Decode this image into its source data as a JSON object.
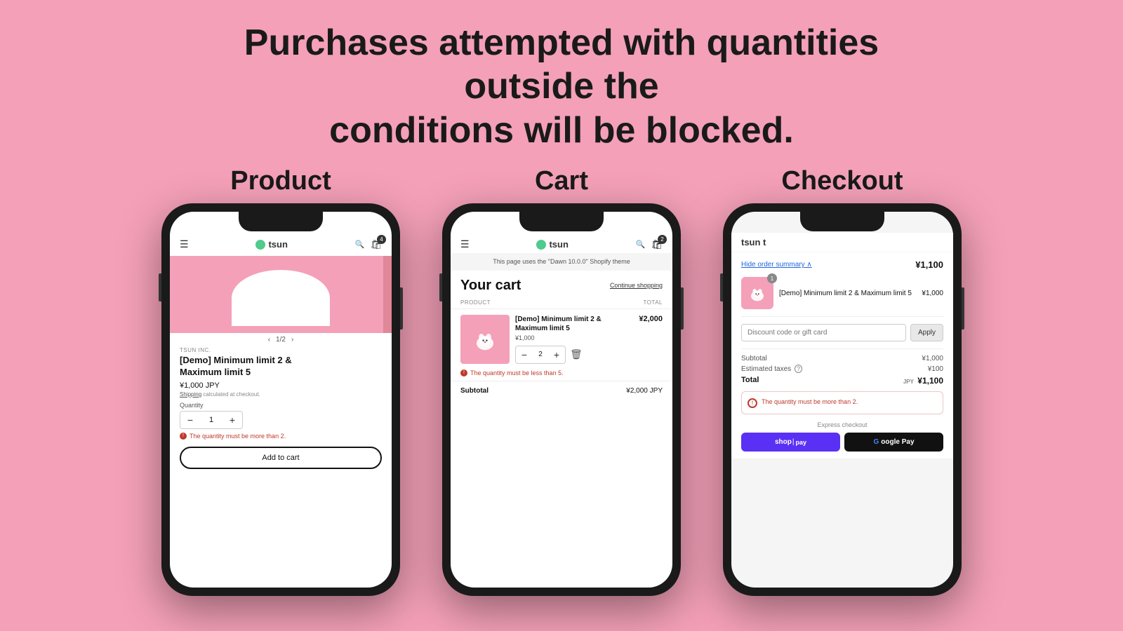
{
  "headline": {
    "line1": "Purchases attempted with quantities outside the",
    "line2": "conditions will be blocked."
  },
  "sections": {
    "product": {
      "label": "Product"
    },
    "cart": {
      "label": "Cart"
    },
    "checkout": {
      "label": "Checkout"
    }
  },
  "product_phone": {
    "brand": "TSUN INC.",
    "title": "Demo Minimum limit 2 & Maximum limit 5",
    "title_display": "[Demo] Minimum limit 2 &\nMaximum limit 5",
    "price": "¥1,000 JPY",
    "shipping": "Shipping",
    "shipping_suffix": "calculated at checkout.",
    "quantity_label": "Quantity",
    "quantity": "1",
    "pagination": "1/2",
    "error": "The quantity must be more than 2.",
    "add_to_cart": "Add to cart",
    "cart_count": "4"
  },
  "cart_phone": {
    "theme_notice": "This page uses the \"Dawn 10.0.0\" Shopify theme",
    "title": "Your cart",
    "continue_shopping": "Continue shopping",
    "col_product": "PRODUCT",
    "col_total": "TOTAL",
    "item_name": "[Demo] Minimum limit 2 & Maximum limit 5",
    "item_price": "¥1,000",
    "item_total": "¥2,000",
    "quantity": "2",
    "error": "The quantity must be less than 5.",
    "subtotal_label": "Subtotal",
    "subtotal_value": "¥2,000 JPY",
    "cart_count": "2"
  },
  "checkout_phone": {
    "header": "tsun t",
    "order_summary_label": "Hide order summary",
    "order_summary_total": "¥1,100",
    "product_name": "[Demo] Minimum limit 2 & Maximum limit 5",
    "product_price": "¥1,000",
    "badge_count": "1",
    "discount_placeholder": "Discount code or gift card",
    "apply_label": "Apply",
    "subtotal_label": "Subtotal",
    "subtotal_value": "¥1,000",
    "taxes_label": "Estimated taxes",
    "taxes_value": "¥100",
    "total_label": "Total",
    "total_currency": "JPY",
    "total_value": "¥1,100",
    "error": "The quantity must be more than 2.",
    "express_label": "Express checkout",
    "shop_pay": "shop",
    "shop_pay2": "pay",
    "gpay": "Google Pay"
  }
}
